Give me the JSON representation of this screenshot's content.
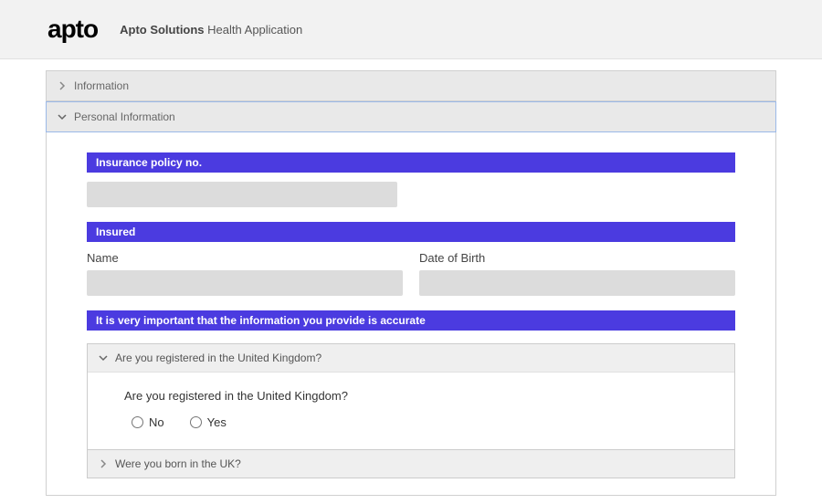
{
  "header": {
    "logo_text": "apto",
    "company": "Apto Solutions",
    "app_name": "Health Application"
  },
  "sections": {
    "info": {
      "label": "Information"
    },
    "personal": {
      "label": "Personal Information"
    }
  },
  "bands": {
    "policy_no": "Insurance policy no.",
    "insured": "Insured",
    "accuracy": "It is very important that the information you provide is accurate"
  },
  "fields": {
    "name_label": "Name",
    "dob_label": "Date of Birth"
  },
  "questions": {
    "q1_header": "Are you registered in the United Kingdom?",
    "q1_text": "Are you registered in the United Kingdom?",
    "q1_no": "No",
    "q1_yes": "Yes",
    "q2_header": "Were you born in the UK?"
  }
}
